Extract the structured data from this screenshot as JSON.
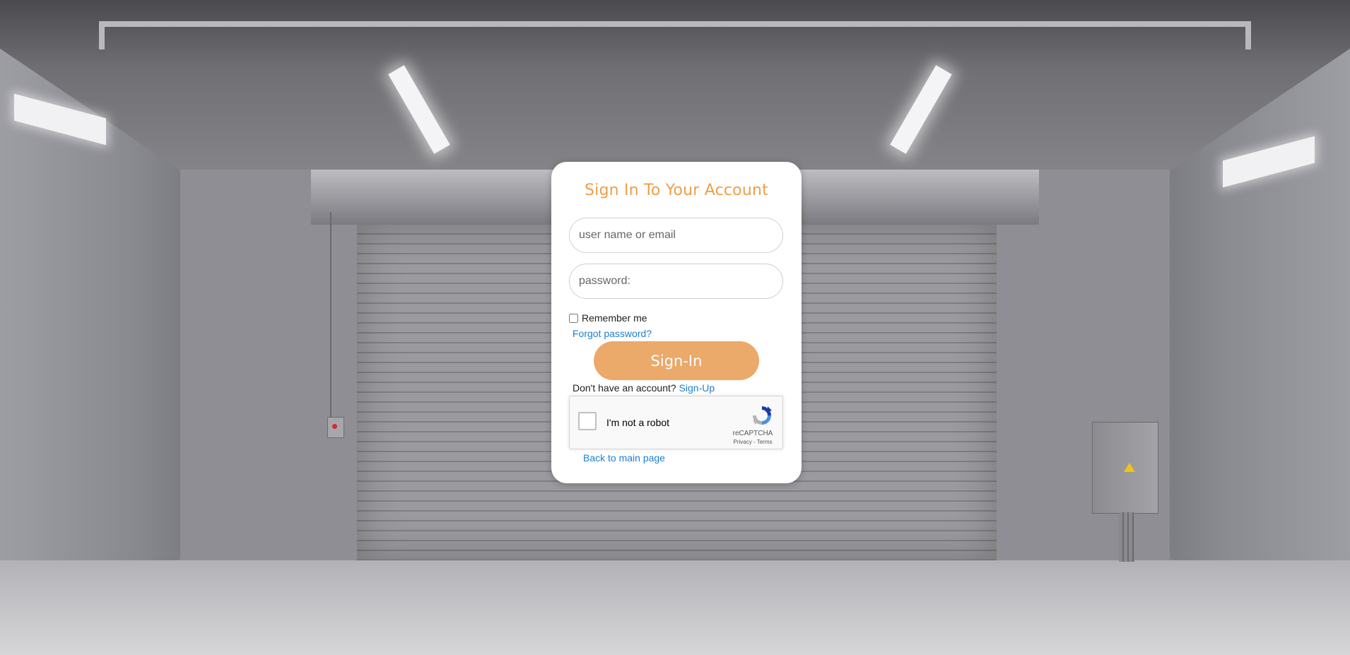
{
  "login": {
    "title": "Sign In To Your Account",
    "username_placeholder": "user name or email",
    "password_placeholder": "password:",
    "remember_label": "Remember me",
    "forgot_label": "Forgot password?",
    "signin_label": "Sign-In",
    "signup_prompt": "Don't have an account?",
    "signup_label": "Sign-Up",
    "back_label": "Back to main page"
  },
  "captcha": {
    "label": "I'm not a robot",
    "brand": "reCAPTCHA",
    "privacy": "Privacy",
    "separator": " - ",
    "terms": "Terms"
  },
  "colors": {
    "accent": "#ef9e4a",
    "button": "#eba96a",
    "link": "#1d7fd1"
  },
  "icons": {
    "captcha_logo": "recaptcha-icon"
  }
}
